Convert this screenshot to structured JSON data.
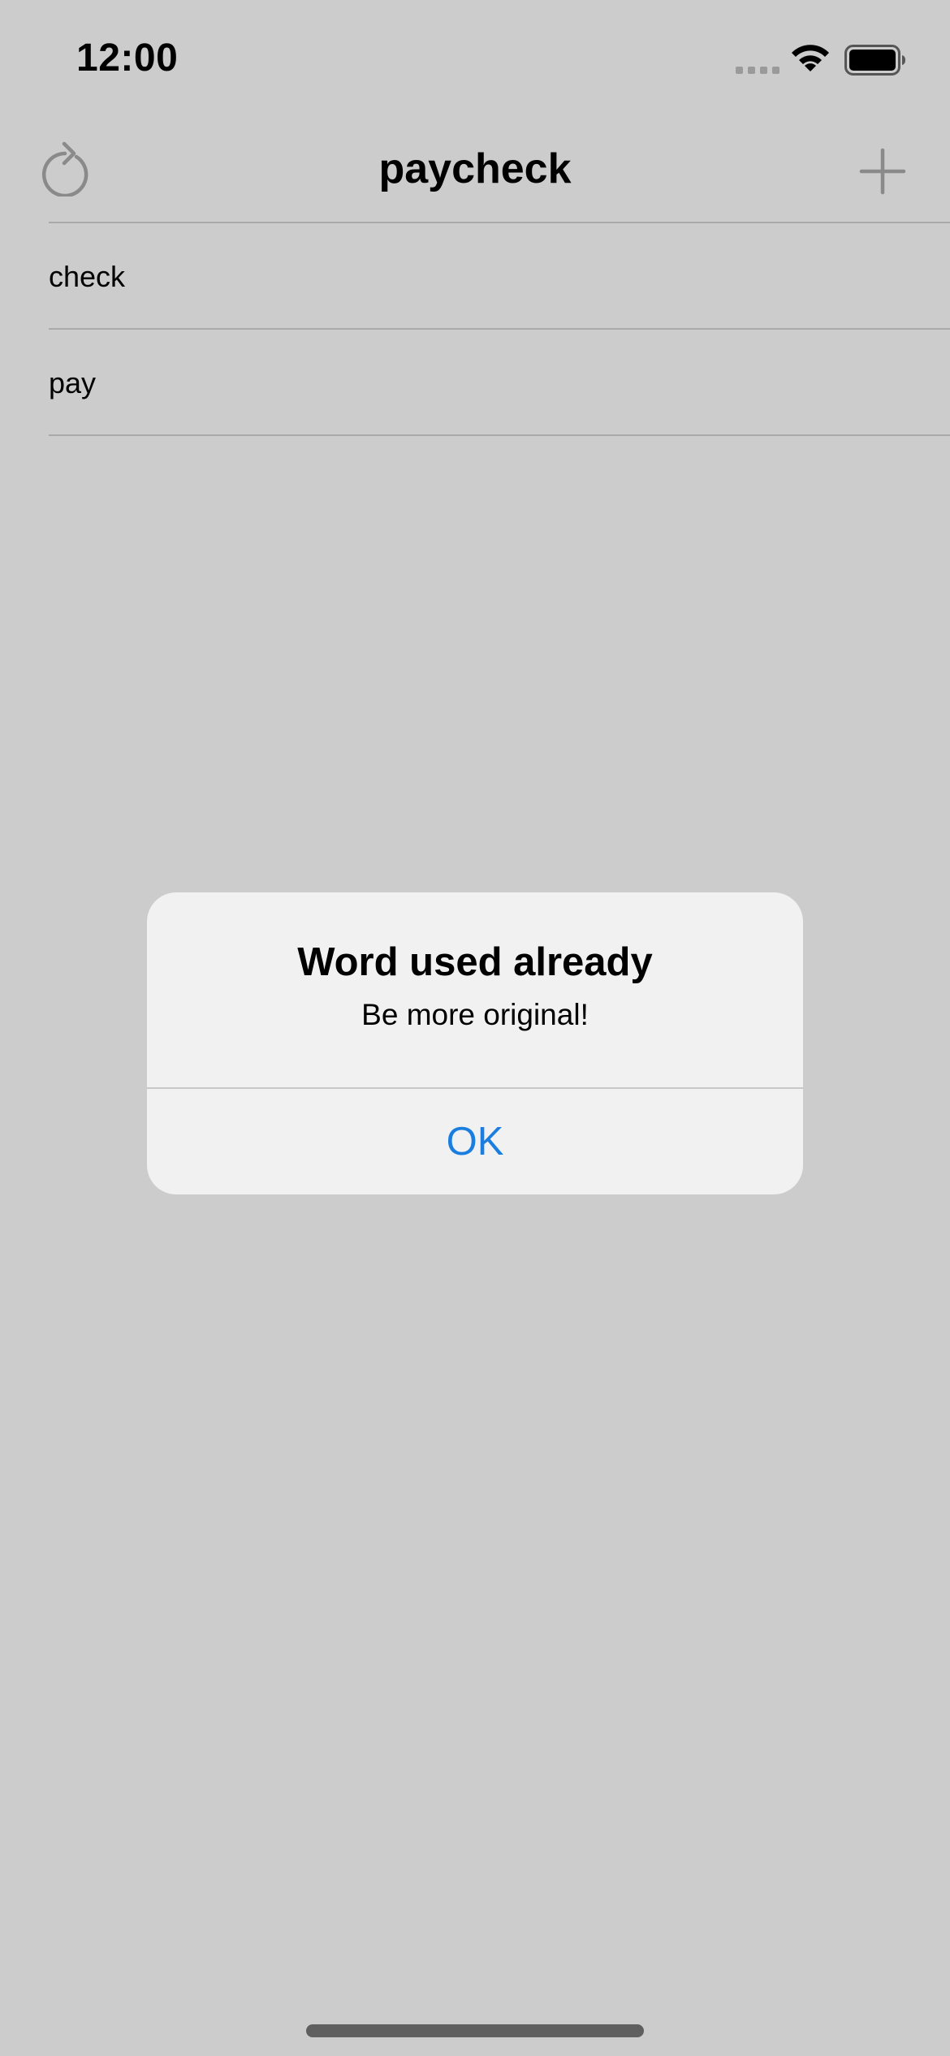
{
  "status_bar": {
    "time": "12:00"
  },
  "nav": {
    "title": "paycheck",
    "left_icon": "refresh-icon",
    "right_icon": "plus-icon"
  },
  "list": {
    "items": [
      {
        "label": "check"
      },
      {
        "label": "pay"
      }
    ]
  },
  "alert": {
    "title": "Word used already",
    "message": "Be more original!",
    "button_label": "OK"
  },
  "colors": {
    "background_dimmed": "#cccccc",
    "alert_background": "#f1f1f1",
    "accent": "#1a7ee0",
    "icon_gray": "#8a8a8a"
  }
}
